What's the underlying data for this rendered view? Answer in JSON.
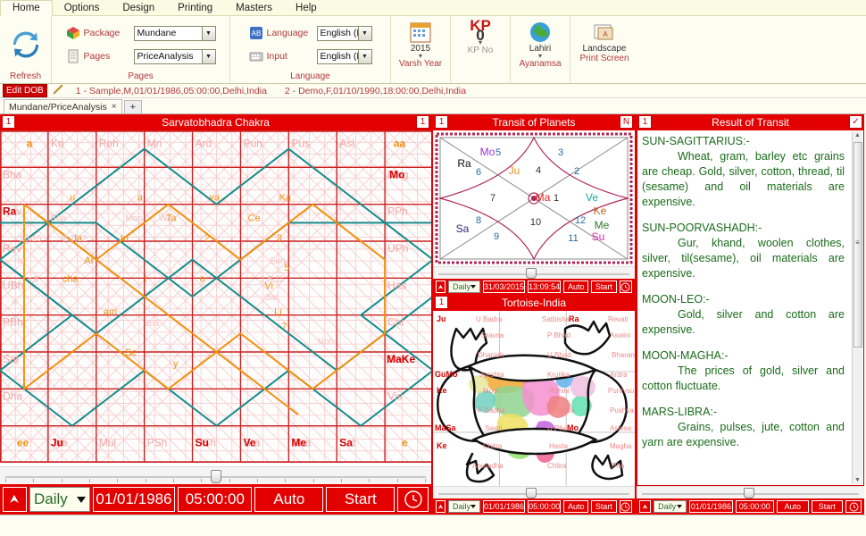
{
  "ribbon": {
    "tabs": [
      {
        "label": "Home",
        "active": true
      },
      {
        "label": "Options",
        "active": false
      },
      {
        "label": "Design",
        "active": false
      },
      {
        "label": "Printing",
        "active": false
      },
      {
        "label": "Masters",
        "active": false
      },
      {
        "label": "Help",
        "active": false
      }
    ],
    "refresh_label": "Refresh",
    "pages_group": {
      "label": "Pages",
      "package_label": "Package",
      "package_value": "Mundane",
      "pages_label": "Pages",
      "pages_value": "PriceAnalysis"
    },
    "language_group": {
      "label": "Language",
      "language_label": "Language",
      "language_value": "English (E",
      "input_label": "Input",
      "input_value": "English (E"
    },
    "varsh": {
      "value": "2015",
      "label": "Varsh Year"
    },
    "kp": {
      "value": "KP",
      "number": "0",
      "label": "KP No"
    },
    "ayanamsa": {
      "value": "Lahiri",
      "label": "Ayanamsa"
    },
    "print": {
      "value": "Landscape",
      "label": "Print Screen"
    }
  },
  "dobbar": {
    "edit_button": "Edit DOB",
    "entries": [
      "1 - Sample,M,01/01/1986,05:00:00,Delhi,India",
      "2 - Demo,F,01/10/1990,18:00:00,Delhi,India"
    ]
  },
  "doctabs": {
    "tabs": [
      {
        "label": "Mundane/PriceAnalysis",
        "close": "×"
      }
    ],
    "add": "+"
  },
  "chakra": {
    "badge": "1",
    "title": "Sarvatobhadra Chakra",
    "corner_top_left": "a",
    "corner_top_right": "aa",
    "corner_bottom_left": "ee",
    "corner_bottom_right": "e",
    "top_nakshatras": [
      "Kri",
      "Roh",
      "Mri",
      "Ard",
      "Pun",
      "Pus",
      "Asl"
    ],
    "left_nakshatras": [
      "Bha",
      "Rav",
      "Rev",
      "UBh",
      "PBh",
      "Sat",
      "Dha"
    ],
    "right_nakshatras": [
      "Mag",
      "PPh",
      "UPh",
      "Has",
      "Chi",
      "Swa",
      "Vis"
    ],
    "bottom_nakshatras": [
      "Jye",
      "Mul",
      "PSh",
      "USh",
      "Sra",
      "Dha",
      "Sat"
    ],
    "planet_markers": [
      {
        "label": "Ra",
        "side": "left",
        "index": 1
      },
      {
        "label": "Mo",
        "side": "right",
        "index": 0
      },
      {
        "label": "MaKe",
        "side": "right",
        "index": 5
      },
      {
        "label": "Ju",
        "side": "bottom",
        "index": 0
      },
      {
        "label": "Su",
        "side": "bottom",
        "index": 3
      },
      {
        "label": "Ve",
        "side": "bottom",
        "index": 4
      },
      {
        "label": "Me",
        "side": "bottom",
        "index": 5
      },
      {
        "label": "Sa",
        "side": "bottom",
        "index": 6
      }
    ],
    "vowel_row": [
      "u",
      "a",
      "va"
    ],
    "inner_letters": [
      "Ta",
      "Ce",
      "la",
      "Iri",
      "2",
      "3",
      "Ar",
      "cha",
      "am",
      "Vi",
      "Li",
      "Sc"
    ]
  },
  "transit": {
    "badge": "1",
    "title": "Transit of Planets",
    "corner_badge": "N",
    "houses": [
      1,
      2,
      3,
      4,
      5,
      6,
      7,
      8,
      9,
      10,
      11,
      12
    ],
    "planets": [
      {
        "name": "Ra",
        "color": "#111111"
      },
      {
        "name": "Mo",
        "color": "#9b30d9"
      },
      {
        "name": "Ju",
        "color": "#e8921b"
      },
      {
        "name": "Ma",
        "color": "#e02020"
      },
      {
        "name": "Ve",
        "color": "#1aa3a3"
      },
      {
        "name": "Ke",
        "color": "#b5651d"
      },
      {
        "name": "Sa",
        "color": "#2b2b7a"
      },
      {
        "name": "Me",
        "color": "#2f7a2f"
      },
      {
        "name": "Su",
        "color": "#e020b0"
      }
    ],
    "controls": {
      "frequency": "Daily",
      "date": "31/03/2015",
      "time": "13:09:54",
      "auto": "Auto",
      "start": "Start"
    }
  },
  "map": {
    "badge": "1",
    "title": "Tortoise-India",
    "labels": [
      "Ju",
      "U Badra",
      "Satbisha",
      "Ra",
      "Revati",
      "Sravna",
      "P Bhad",
      "Aswini",
      "Dhanish",
      "U Bhad",
      "Bharani",
      "GuMo",
      "Jyeshta",
      "Krutika",
      "Ardra",
      "Ke",
      "Mool",
      "Rohini",
      "Punrvsu",
      "P Sadha",
      "Mrigsira",
      "Pushya",
      "MaSa",
      "Swati",
      "U Pha",
      "Mo",
      "Aslesa",
      "Ke",
      "Chitra",
      "Hasta",
      "Magha",
      "Anuradha",
      "Chitra",
      "Pha"
    ],
    "controls": {
      "frequency": "Daily",
      "date": "01/01/1986",
      "time": "05:00:00",
      "auto": "Auto",
      "start": "Start"
    }
  },
  "result": {
    "badge": "1",
    "title": "Result of Transit",
    "check": "✓",
    "sections": [
      {
        "heading": "SUN-SAGITTARIUS:-",
        "body": "Wheat, gram, barley etc grains are cheap. Gold, silver, cotton, thread, til (sesame) and oil materials are expensive."
      },
      {
        "heading": "SUN-POORVASHADH:-",
        "body": "Gur, khand, woolen clothes, silver, til(sesame), oil materials are expensive."
      },
      {
        "heading": "MOON-LEO:-",
        "body": "Gold, silver and cotton are expensive."
      },
      {
        "heading": "MOON-MAGHA:-",
        "body": "The prices of gold, silver and cotton fluctuate."
      },
      {
        "heading": "MARS-LIBRA:-",
        "body": "Grains, pulses, jute, cotton and yarn are expensive."
      }
    ],
    "controls": {
      "frequency": "Daily",
      "date": "01/01/1986",
      "time": "05:00:00",
      "auto": "Auto",
      "start": "Start"
    }
  },
  "main_controls": {
    "frequency": "Daily",
    "date": "01/01/1986",
    "time": "05:00:00",
    "auto": "Auto",
    "start": "Start"
  },
  "colors": {
    "accent_red": "#e30000",
    "label_red": "#b5373c",
    "result_green": "#1a6b1a",
    "grid_pink": "#f2a7a7",
    "grid_red": "#cc2222",
    "teal": "#1a8f8f",
    "orange": "#f0920f"
  }
}
